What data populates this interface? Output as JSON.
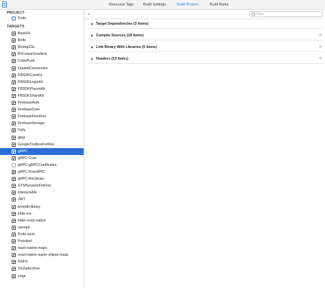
{
  "tabs": [
    {
      "label": "Resource Tags",
      "active": false
    },
    {
      "label": "Build Settings",
      "active": false
    },
    {
      "label": "Build Phases",
      "active": true
    },
    {
      "label": "Build Rules",
      "active": false
    }
  ],
  "sidebar": {
    "project_header": "PROJECT",
    "project_item": "Pods",
    "targets_header": "TARGETS",
    "targets": [
      "Base64",
      "Bolts",
      "BoringSSL",
      "BVLinearGradient",
      "CodePush",
      "DoubleConversion",
      "FBSDKCoreKit",
      "FBSDKLoginKit",
      "FBSDKPlacesKit",
      "FBSDKShareKit",
      "FirebaseAuth",
      "FirebaseCore",
      "FirebaseFirestore",
      "FirebaseStorage",
      "Folly",
      "glog",
      "GoogleToolboxForMac",
      "gRPC",
      "gRPC-Core",
      "gRPC-gRPCCertificates",
      "gRPC-ProtoRPC",
      "gRPC-RxLibrary",
      "GTMSessionFetcher",
      "Interactable",
      "JWT",
      "leveldb-library",
      "lottie-ios",
      "lottie-react-native",
      "nanopb",
      "Pods-sesh",
      "Protobuf",
      "react-native-maps",
      "react-native-super-ellipse-mask",
      "RNFS",
      "SSZipArchive",
      "yoga"
    ],
    "selected": "gRPC"
  },
  "main": {
    "add_label": "+",
    "filter_placeholder": "Filter",
    "phases": [
      {
        "title": "Target Dependencies (3 items)",
        "removable": false
      },
      {
        "title": "Compile Sources (18 items)",
        "removable": true
      },
      {
        "title": "Link Binary With Libraries (0 items)",
        "removable": true
      },
      {
        "title": "Headers (19 items)",
        "removable": true
      }
    ],
    "close_glyph": "×"
  },
  "colors": {
    "accent": "#2f7be0",
    "selection": "#2a6fd6"
  }
}
